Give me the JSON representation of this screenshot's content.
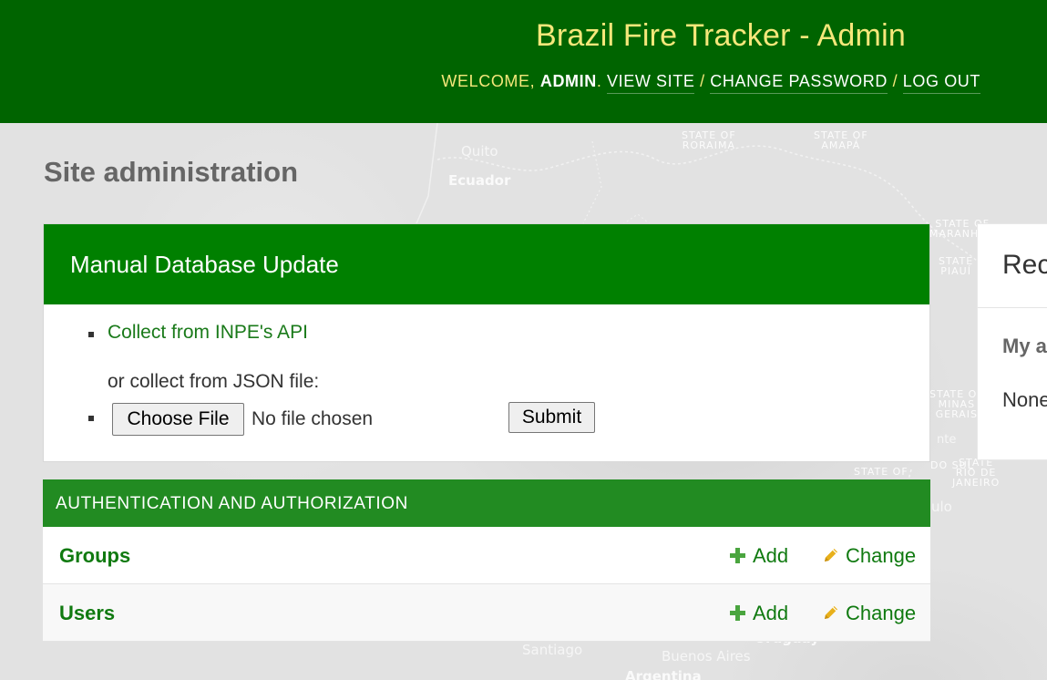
{
  "header": {
    "site_name": "Brazil Fire Tracker - Admin",
    "welcome_prefix": "WELCOME, ",
    "username": "ADMIN",
    "welcome_suffix": ". ",
    "separator": " / ",
    "view_site": "VIEW SITE",
    "change_password": "CHANGE PASSWORD",
    "log_out": "LOG OUT"
  },
  "page_title": "Site administration",
  "manual_update": {
    "caption": "Manual Database Update",
    "api_link": "Collect from INPE's API",
    "or_text": "or collect from JSON file:",
    "choose_file": "Choose File",
    "no_file": "No file chosen",
    "submit": "Submit"
  },
  "auth": {
    "caption": "AUTHENTICATION AND AUTHORIZATION",
    "models": [
      {
        "name": "Groups",
        "add": "Add",
        "change": "Change"
      },
      {
        "name": "Users",
        "add": "Add",
        "change": "Change"
      }
    ]
  },
  "recent_actions": {
    "caption": "Rec",
    "subtitle": "My a",
    "empty": "None"
  },
  "map_labels": {
    "roraima": "STATE OF\nRORAIMA",
    "amapa": "STATE OF\nAMAPÁ",
    "maranhao": "STATE OF\nMARANHÃO",
    "piaui": "STATE\nPIAUÍ",
    "minas": "STATE OF\nMINAS\nGERAIS",
    "sul": "DO SUL",
    "state_of": "STATE OF",
    "rio": "STATE\nRIO DE\nJANEIRO",
    "quito": "Quito",
    "ecuador": "Ecuador",
    "santiago": "Santiago",
    "buenos_aires": "Buenos Aires",
    "argentina": "Argentina",
    "uruguay": "Uruguay",
    "ulo": "ulo",
    "nte": "nte"
  },
  "colors": {
    "header_bg": "#006400",
    "branding": "#f5e77a",
    "module_caption": "#008000",
    "auth_caption": "#228b22",
    "link": "#107a10",
    "add_icon": "#4aa53f",
    "change_icon": "#e8b01b"
  },
  "icons": {
    "add": "plus-icon",
    "change": "pencil-icon"
  }
}
